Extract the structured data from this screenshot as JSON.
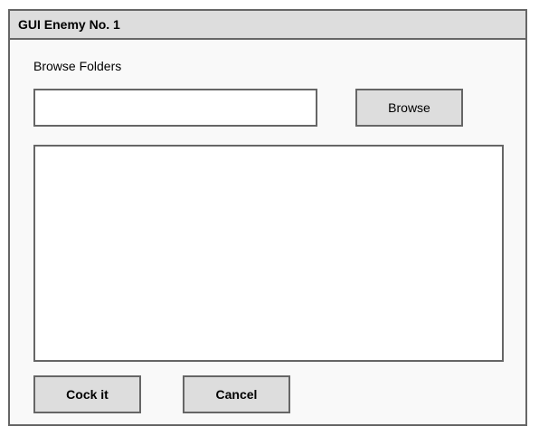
{
  "window": {
    "title": "GUI Enemy No. 1"
  },
  "browse": {
    "label": "Browse Folders",
    "input_value": "",
    "button_label": "Browse"
  },
  "actions": {
    "ok_label": "Cock it",
    "cancel_label": "Cancel"
  },
  "colors": {
    "title_bar": "#dddddd",
    "border": "#666666",
    "window_bg": "#f9f9f9",
    "button_bg": "#dddddd"
  }
}
